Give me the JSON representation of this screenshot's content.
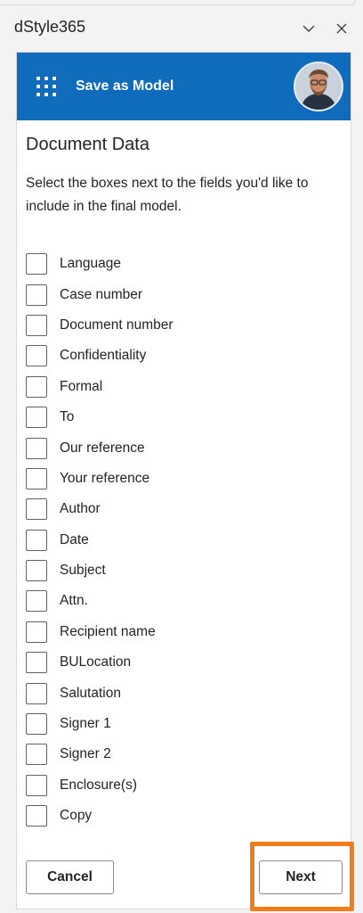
{
  "window": {
    "app_title": "dStyle365",
    "collapse_icon": "chevron-down-icon",
    "close_icon": "close-icon"
  },
  "header": {
    "menu_icon": "waffle-icon",
    "title": "Save as Model",
    "background": "#0f6cbd"
  },
  "content": {
    "title": "Document Data",
    "description": "Select the boxes next to the fields you'd like to include in the final model."
  },
  "fields": [
    {
      "label": "Language",
      "checked": false
    },
    {
      "label": "Case number",
      "checked": false
    },
    {
      "label": "Document number",
      "checked": false
    },
    {
      "label": "Confidentiality",
      "checked": false
    },
    {
      "label": "Formal",
      "checked": false
    },
    {
      "label": "To",
      "checked": false
    },
    {
      "label": "Our reference",
      "checked": false
    },
    {
      "label": "Your reference",
      "checked": false
    },
    {
      "label": "Author",
      "checked": false
    },
    {
      "label": "Date",
      "checked": false
    },
    {
      "label": "Subject",
      "checked": false
    },
    {
      "label": "Attn.",
      "checked": false
    },
    {
      "label": "Recipient name",
      "checked": false
    },
    {
      "label": "BULocation",
      "checked": false
    },
    {
      "label": "Salutation",
      "checked": false
    },
    {
      "label": "Signer 1",
      "checked": false
    },
    {
      "label": "Signer 2",
      "checked": false
    },
    {
      "label": "Enclosure(s)",
      "checked": false
    },
    {
      "label": "Copy",
      "checked": false
    }
  ],
  "footer": {
    "cancel_label": "Cancel",
    "next_label": "Next",
    "highlight_color": "#f07c1a"
  }
}
